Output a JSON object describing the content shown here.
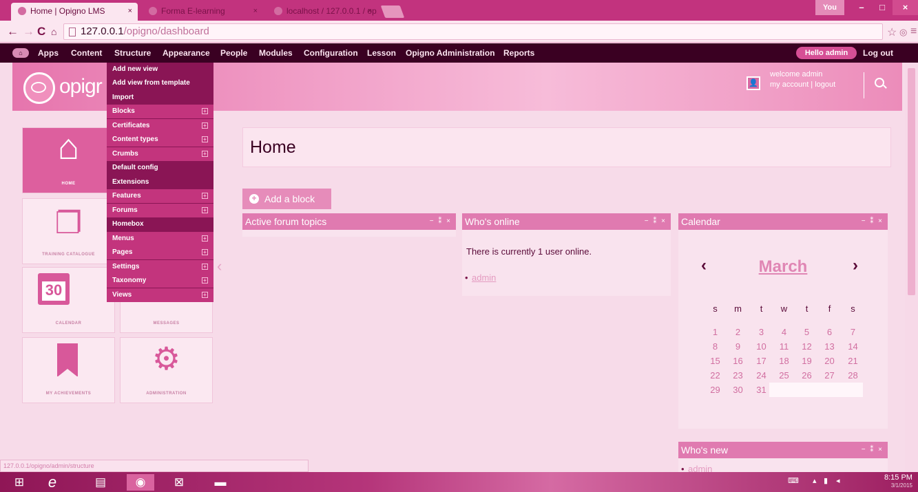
{
  "browser": {
    "tabs": [
      {
        "label": "Home | Opigno LMS",
        "close": "×"
      },
      {
        "label": "Forma E-learning",
        "close": "×"
      },
      {
        "label": "localhost / 127.0.0.1 / op...",
        "close": "×"
      }
    ],
    "window_user": "You",
    "url_host": "127.0.0.1",
    "url_path": "/opigno/dashboard"
  },
  "toolbar": {
    "items": [
      "Apps",
      "Content",
      "Structure",
      "Appearance",
      "People",
      "Modules",
      "Configuration",
      "Lesson",
      "Opigno Administration",
      "Reports"
    ],
    "hello_prefix": "Hello ",
    "hello_user": "admin",
    "logout": "Log out"
  },
  "header": {
    "logo_text": "opigr",
    "welcome": "welcome admin",
    "account_links": "my account | logout"
  },
  "structure_menu": {
    "items": [
      {
        "label": "Add new view",
        "sub": false,
        "light": false
      },
      {
        "label": "Add view from template",
        "sub": false,
        "light": false
      },
      {
        "label": "Import",
        "sub": false,
        "light": false
      },
      {
        "label": "Blocks",
        "sub": true,
        "light": true
      },
      {
        "label": "Certificates",
        "sub": true,
        "light": true
      },
      {
        "label": "Content types",
        "sub": true,
        "light": true
      },
      {
        "label": "Crumbs",
        "sub": true,
        "light": true
      },
      {
        "label": "Default config",
        "sub": false,
        "light": false
      },
      {
        "label": "Extensions",
        "sub": false,
        "light": false
      },
      {
        "label": "Features",
        "sub": true,
        "light": true
      },
      {
        "label": "Forums",
        "sub": true,
        "light": true
      },
      {
        "label": "Homebox",
        "sub": false,
        "light": false
      },
      {
        "label": "Menus",
        "sub": true,
        "light": true
      },
      {
        "label": "Pages",
        "sub": true,
        "light": true
      },
      {
        "label": "Settings",
        "sub": true,
        "light": true
      },
      {
        "label": "Taxonomy",
        "sub": true,
        "light": true
      },
      {
        "label": "Views",
        "sub": true,
        "light": true
      }
    ]
  },
  "tiles": {
    "home": "HOME",
    "training_catalogue": "TRAINING CATALOGUE",
    "calendar": "CALENDAR",
    "calendar_day": "30",
    "messages": "MESSAGES",
    "achievements": "MY ACHIEVEMENTS",
    "administration": "ADMINISTRATION"
  },
  "main": {
    "page_title": "Home",
    "add_block": "Add a block",
    "blocks": {
      "forum": {
        "title": "Active forum topics"
      },
      "online": {
        "title": "Who's online",
        "text": "There is currently 1 user online.",
        "user": "admin"
      },
      "calendar": {
        "title": "Calendar",
        "month": "March",
        "days_of_week": [
          "s",
          "m",
          "t",
          "w",
          "t",
          "f",
          "s"
        ],
        "weeks": [
          [
            "1",
            "2",
            "3",
            "4",
            "5",
            "6",
            "7"
          ],
          [
            "8",
            "9",
            "10",
            "11",
            "12",
            "13",
            "14"
          ],
          [
            "15",
            "16",
            "17",
            "18",
            "19",
            "20",
            "21"
          ],
          [
            "22",
            "23",
            "24",
            "25",
            "26",
            "27",
            "28"
          ],
          [
            "29",
            "30",
            "31"
          ]
        ]
      },
      "whos_new": {
        "title": "Who's new",
        "user": "admin"
      }
    },
    "block_controls": "− ⁑ ×"
  },
  "status_url": "127.0.0.1/opigno/admin/structure",
  "taskbar": {
    "time": "8:15 PM",
    "date": "3/1/2015"
  }
}
